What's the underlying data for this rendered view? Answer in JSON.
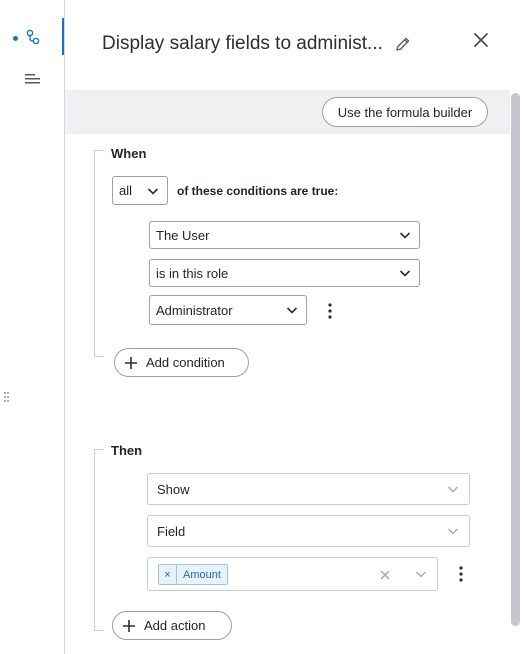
{
  "rail": {
    "items": [
      {
        "icon": "rules-icon",
        "active": true
      },
      {
        "icon": "list-icon",
        "active": false
      }
    ],
    "accent_color": "#1a73c7"
  },
  "header": {
    "title": "Display salary fields to administ...",
    "edit_icon": "pencil-icon",
    "close_icon": "close-icon"
  },
  "toolbar": {
    "formula_button_label": "Use the formula builder"
  },
  "when": {
    "label": "When",
    "match_select": "all",
    "match_text": "of these conditions are true:",
    "conditions": {
      "subject": "The User",
      "operator": "is in this role",
      "value": "Administrator"
    },
    "add_condition_label": "Add condition"
  },
  "then": {
    "label": "Then",
    "action_select": "Show",
    "target_select": "Field",
    "field_chip": "Amount",
    "chip_remove": "×",
    "add_action_label": "Add action"
  },
  "colors": {
    "chip_background": "#e8f2fb",
    "chip_text": "#1a6db5",
    "border": "#9aa1a8"
  }
}
